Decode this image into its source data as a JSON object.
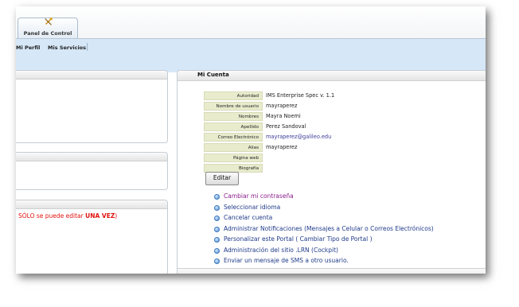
{
  "header": {
    "tab_label": "Panel de Control"
  },
  "subnav": {
    "items": [
      "Mi Perfil",
      "Mis Servicios"
    ]
  },
  "left": {
    "warning_prefix": "SÓLO se puede editar ",
    "warning_bold": "UNA VEZ",
    "warning_suffix": ")"
  },
  "account": {
    "title": "Mi Cuenta",
    "fields": [
      {
        "label": "Autoridad",
        "value": "IMS Enterprise Spec v. 1.1"
      },
      {
        "label": "Nombre de usuario",
        "value": "mayraperez"
      },
      {
        "label": "Nombres",
        "value": "Mayra Noemi"
      },
      {
        "label": "Apellido",
        "value": "Perez Sandoval"
      },
      {
        "label": "Correo Electrónico",
        "value": "mayraperez@galileo.edu"
      },
      {
        "label": "Alias",
        "value": "mayraperez"
      },
      {
        "label": "Página web",
        "value": ""
      },
      {
        "label": "Biografía",
        "value": ""
      }
    ],
    "edit_label": "Editar",
    "actions": [
      "Cambiar mi contraseña",
      "Seleccionar idioma",
      "Cancelar cuenta",
      "Administrar Notificaciones (Mensajes a Celular o Correos Electrónicos)",
      "Personalizar este Portal ( Cambiar Tipo de Portal )",
      "Administración del sitio .LRN (Cockpit)",
      "Enviar un mensaje de SMS a otro usuario."
    ]
  },
  "colors": {
    "accent": "#d6e7f7",
    "link": "#1f3a8a",
    "visited_link": "#8b1c8b",
    "warning": "#e1120e",
    "label_bg": "#e8eccd"
  },
  "icons": {
    "tab": "tools-icon",
    "bullet": "bullet-icon"
  }
}
